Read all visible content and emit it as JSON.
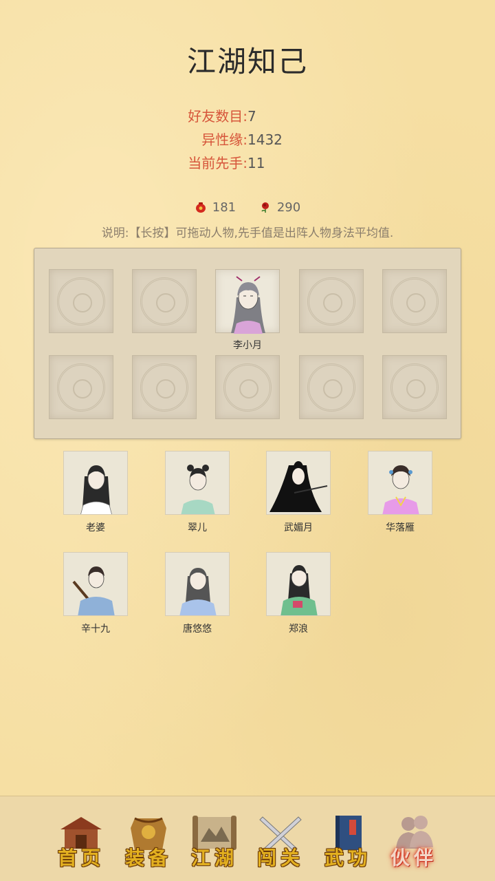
{
  "page": {
    "title": "江湖知己"
  },
  "stats": [
    {
      "label": "好友数目:",
      "value": "7"
    },
    {
      "label": "异性缘:",
      "value": "1432"
    },
    {
      "label": "当前先手:",
      "value": "11"
    }
  ],
  "currency": [
    {
      "icon": "red-pouch-icon",
      "value": "181",
      "color": "#d42a1e"
    },
    {
      "icon": "rose-icon",
      "value": "290",
      "color": "#c0201a"
    }
  ],
  "hint": "说明:【长按】可拖动人物,先手值是出阵人物身法平均值.",
  "formation": {
    "slots": [
      {
        "name": ""
      },
      {
        "name": ""
      },
      {
        "name": "李小月"
      },
      {
        "name": ""
      },
      {
        "name": ""
      },
      {
        "name": ""
      },
      {
        "name": ""
      },
      {
        "name": ""
      },
      {
        "name": ""
      },
      {
        "name": ""
      }
    ]
  },
  "companions": [
    {
      "name": "老婆",
      "robe": "#ffffff",
      "hair": "#2a2a2a"
    },
    {
      "name": "翠儿",
      "robe": "#a7d8c3",
      "hair": "#2a2a2a"
    },
    {
      "name": "武媚月",
      "robe": "#222222",
      "hair": "#111111"
    },
    {
      "name": "华落雁",
      "robe": "#e79be8",
      "hair": "#3a2e2a"
    },
    {
      "name": "辛十九",
      "robe": "#8fb1d8",
      "hair": "#3a2e2a"
    },
    {
      "name": "唐悠悠",
      "robe": "#a9c3ea",
      "hair": "#555555"
    },
    {
      "name": "郑浪",
      "robe": "#6fbf8e",
      "hair": "#2a2a2a"
    }
  ],
  "nav": [
    {
      "label": "首页",
      "icon": "house-icon",
      "active": false
    },
    {
      "label": "装备",
      "icon": "armor-icon",
      "active": false
    },
    {
      "label": "江湖",
      "icon": "scroll-map-icon",
      "active": false
    },
    {
      "label": "闯关",
      "icon": "crossed-swords-icon",
      "active": false
    },
    {
      "label": "武功",
      "icon": "book-icon",
      "active": false
    },
    {
      "label": "伙伴",
      "icon": "companions-icon",
      "active": true
    }
  ]
}
